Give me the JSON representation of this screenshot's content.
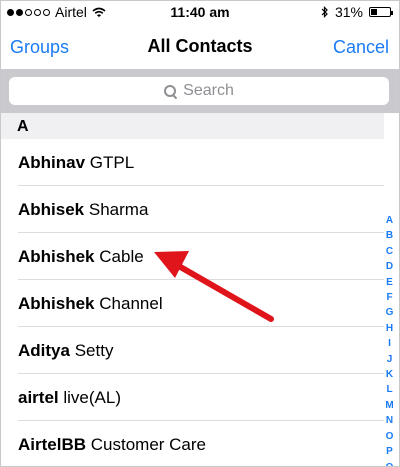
{
  "status_bar": {
    "carrier": "Airtel",
    "time": "11:40 am",
    "battery": "31%",
    "battery_level": 0.31
  },
  "nav": {
    "left": "Groups",
    "title": "All Contacts",
    "right": "Cancel"
  },
  "search": {
    "placeholder": "Search"
  },
  "section": "A",
  "contacts": [
    {
      "first": "Abhinav",
      "last": "GTPL"
    },
    {
      "first": "Abhisek",
      "last": "Sharma"
    },
    {
      "first": "Abhishek",
      "last": "Cable"
    },
    {
      "first": "Abhishek",
      "last": "Channel"
    },
    {
      "first": "Aditya",
      "last": "Setty"
    },
    {
      "first": "airtel",
      "last": "live(AL)"
    },
    {
      "first": "AirtelBB",
      "last": "Customer Care"
    }
  ],
  "index": [
    "A",
    "B",
    "C",
    "D",
    "E",
    "F",
    "G",
    "H",
    "I",
    "J",
    "K",
    "L",
    "M",
    "N",
    "O",
    "P",
    "Q"
  ],
  "annotation": {
    "color": "#e0141b",
    "points_to": "Abhishek Cable"
  },
  "colors": {
    "accent": "#1a7cf5"
  }
}
